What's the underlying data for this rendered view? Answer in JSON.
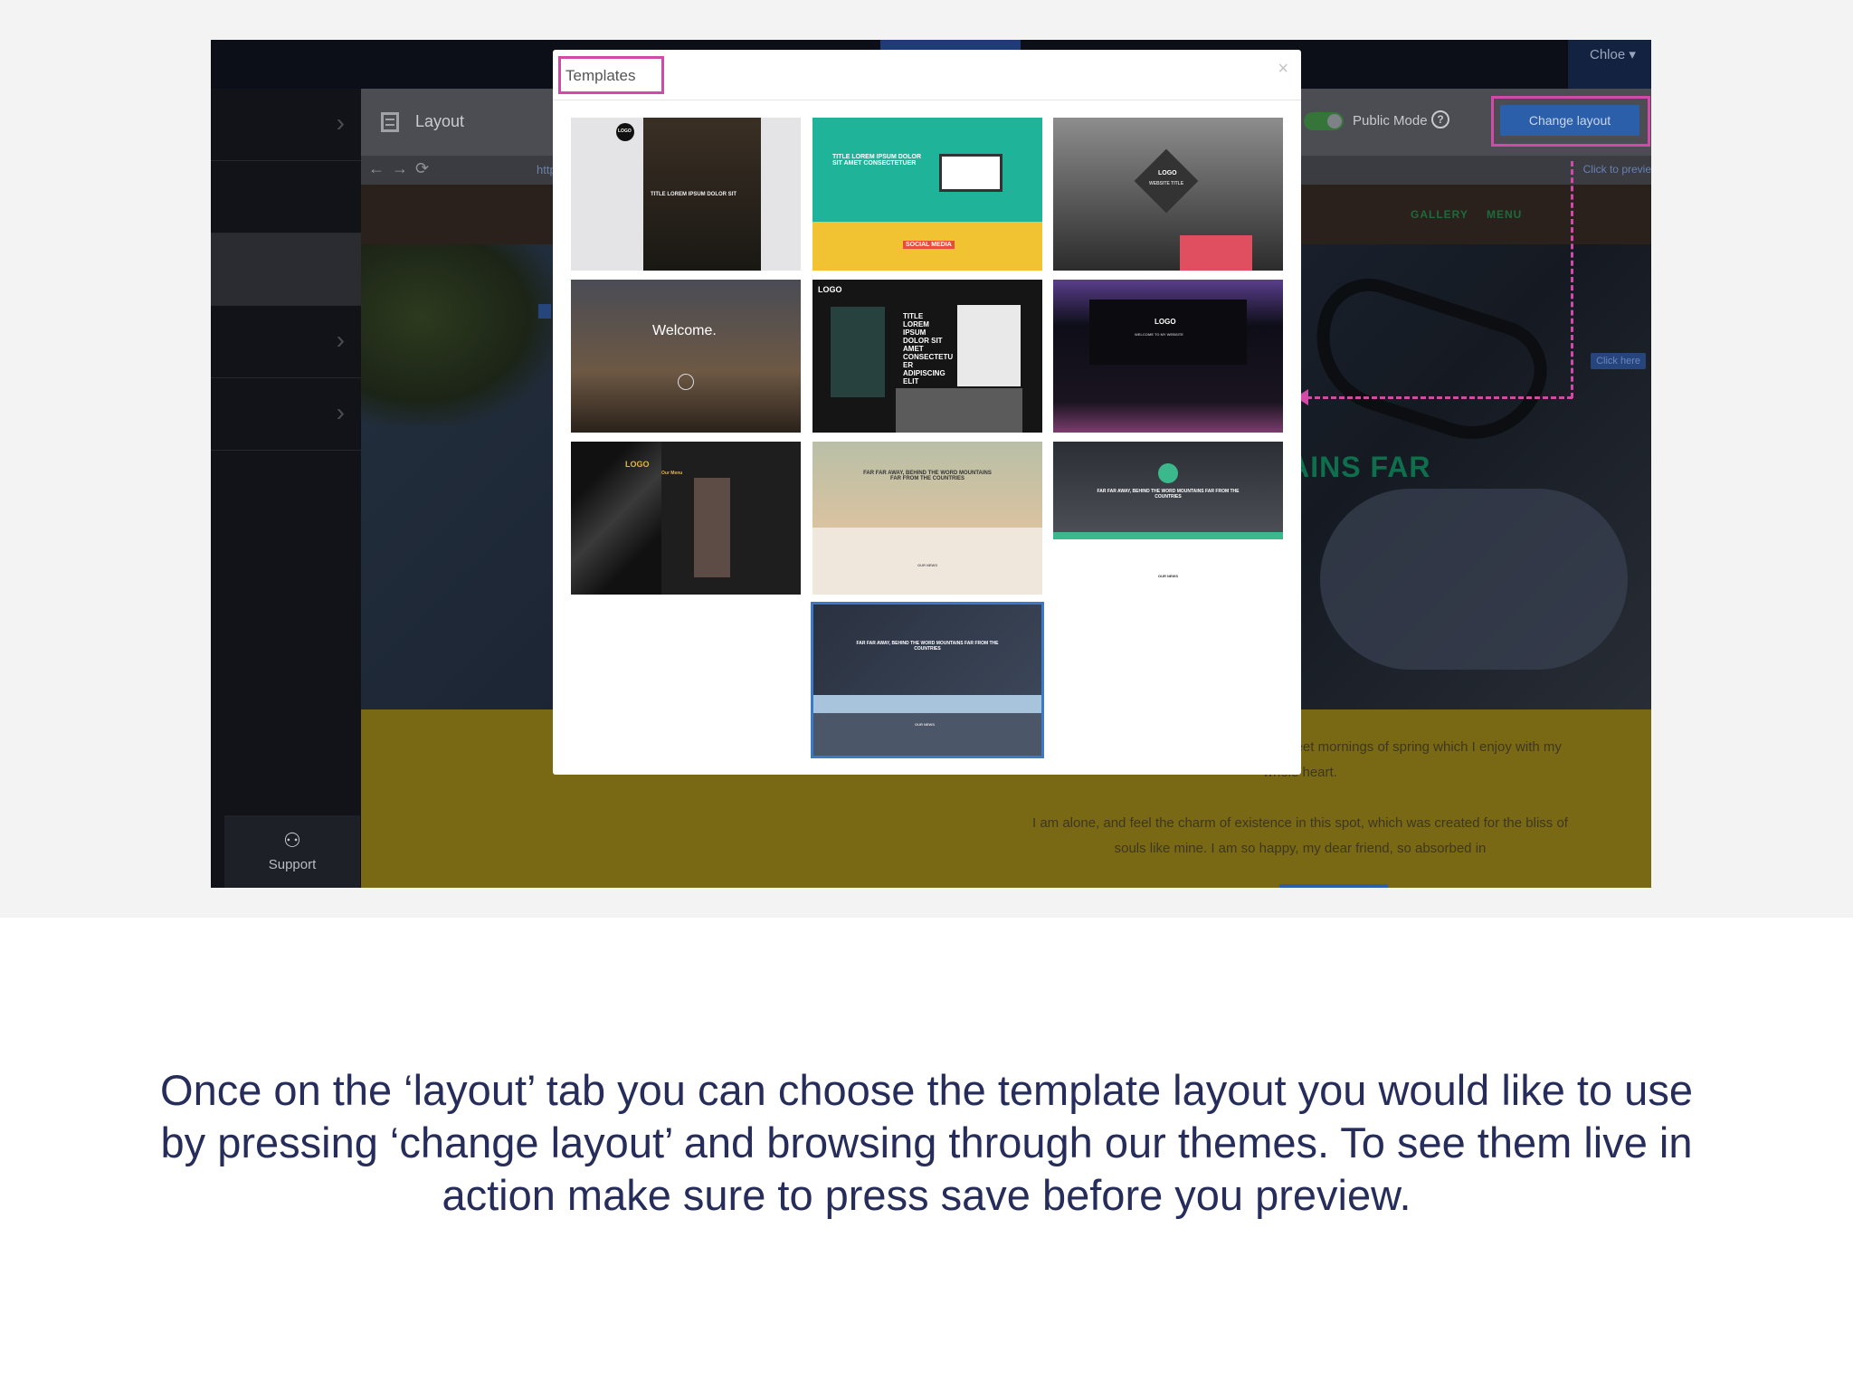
{
  "app": {
    "user_menu": "Chloe ▾",
    "sidebar": {
      "support_label": "Support"
    },
    "toolbar": {
      "title": "Layout",
      "public_mode_label": "Public Mode",
      "help_glyph": "?",
      "change_layout_label": "Change layout"
    },
    "urlbar": {
      "back": "←",
      "forward": "→",
      "reload": "⟳",
      "url": "http",
      "preview_hint": "Click to previe"
    },
    "site": {
      "nav": [
        "GALLERY",
        "MENU"
      ],
      "hero_title": "TAINS FAR",
      "click_here": "Click here",
      "paragraph_1": "possession of my entire soul, like these sweet mornings of spring which I enjoy with my whole heart.",
      "paragraph_2": "I am alone, and feel the charm of existence in this spot, which was created for the bliss of souls like mine. I am so happy, my dear friend, so absorbed in"
    }
  },
  "modal": {
    "title": "Templates",
    "close_glyph": "×",
    "templates": [
      {
        "id": 1,
        "text": "TITLE LOREM IPSUM DOLOR SIT",
        "extra": "LOGO"
      },
      {
        "id": 2,
        "text": "TITLE LOREM IPSUM DOLOR SIT AMET CONSECTETUER",
        "extra": "SOCIAL MEDIA"
      },
      {
        "id": 3,
        "text": "LOGO",
        "extra": "WEBSITE TITLE"
      },
      {
        "id": 4,
        "text": "Welcome.",
        "extra": ""
      },
      {
        "id": 5,
        "text": "TITLE LOREM IPSUM DOLOR SIT AMET CONSECTETU ER ADIPISCING ELIT",
        "extra": "LOGO"
      },
      {
        "id": 6,
        "text": "LOGO",
        "extra": "WELCOME TO MY WEBSITE"
      },
      {
        "id": 7,
        "text": "LOGO",
        "extra": "Our Menu"
      },
      {
        "id": 8,
        "text": "FAR FAR AWAY, BEHIND THE WORD MOUNTAINS FAR FROM THE COUNTRIES",
        "extra": "OUR NEWS"
      },
      {
        "id": 9,
        "text": "FAR FAR AWAY, BEHIND THE WORD MOUNTAINS FAR FROM THE COUNTRIES",
        "extra": "OUR NEWS"
      },
      {
        "id": 10,
        "text": "FAR FAR AWAY, BEHIND THE WORD MOUNTAINS FAR FROM THE COUNTRIES",
        "extra": "OUR NEWS",
        "selected": true
      }
    ]
  },
  "caption": "Once on the ‘layout’ tab you can choose the template layout you would like to use by pressing ‘change layout’ and browsing through our themes. To see them live in action make sure to press save before you preview.",
  "colors": {
    "highlight": "#d24aa7",
    "button": "#2c5fa9",
    "caption_text": "#262d5a",
    "selected_border": "#3a7ac6"
  }
}
